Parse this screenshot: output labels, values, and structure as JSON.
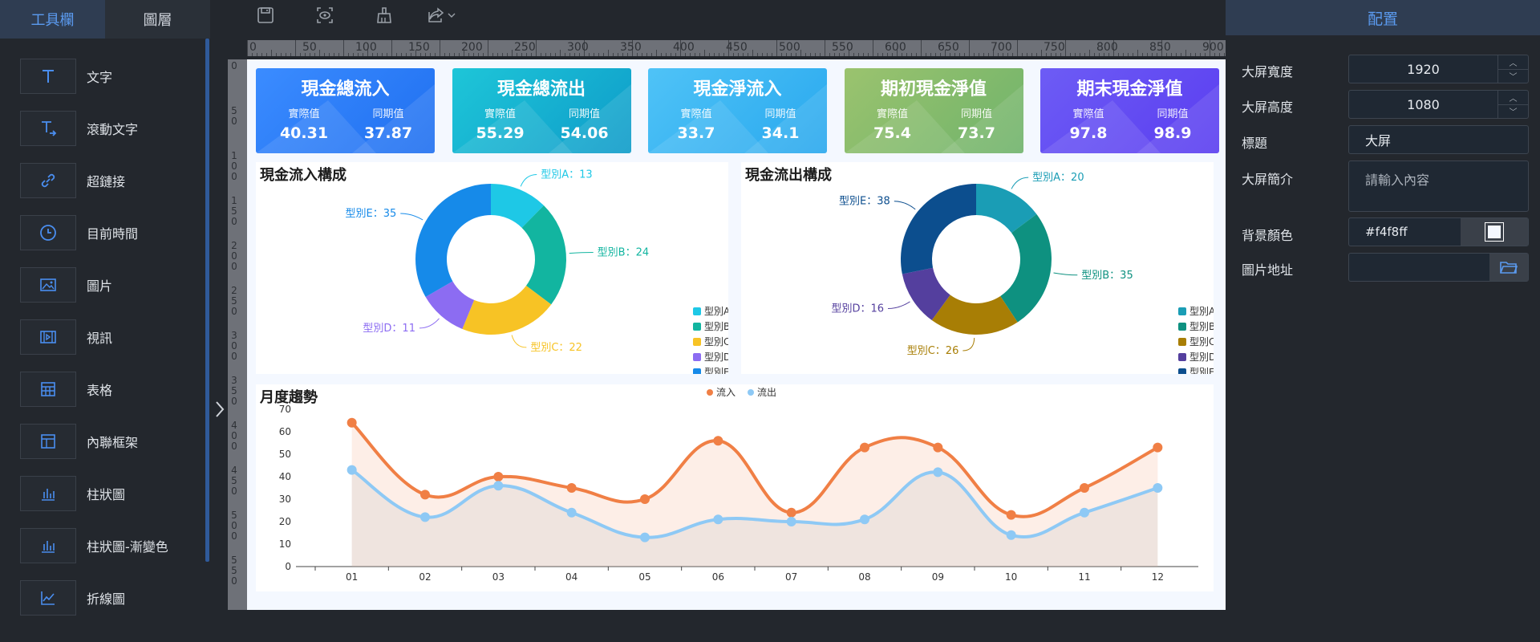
{
  "left_tabs": [
    "工具欄",
    "圖層"
  ],
  "widgets": [
    {
      "label": "文字",
      "icon": "text-icon"
    },
    {
      "label": "滾動文字",
      "icon": "scroll-text-icon"
    },
    {
      "label": "超鏈接",
      "icon": "link-icon"
    },
    {
      "label": "目前時間",
      "icon": "clock-icon"
    },
    {
      "label": "圖片",
      "icon": "image-icon"
    },
    {
      "label": "視訊",
      "icon": "video-icon"
    },
    {
      "label": "表格",
      "icon": "table-icon"
    },
    {
      "label": "內聯框架",
      "icon": "iframe-icon"
    },
    {
      "label": "柱狀圖",
      "icon": "bar-chart-icon"
    },
    {
      "label": "柱狀圖-漸變色",
      "icon": "bar-chart-gradient-icon"
    },
    {
      "label": "折線圖",
      "icon": "line-chart-icon"
    }
  ],
  "toolbar_icons": [
    "save-icon",
    "preview-icon",
    "clean-icon",
    "export-icon"
  ],
  "ruler": {
    "h_labels": [
      "0",
      "50",
      "100",
      "150",
      "200",
      "250",
      "300",
      "350",
      "400",
      "450",
      "500",
      "550",
      "600",
      "650",
      "700",
      "750",
      "800",
      "850",
      "900"
    ]
  },
  "kpis": [
    {
      "title": "現金總流入",
      "l1": "實際值",
      "l2": "同期值",
      "v1": "40.31",
      "v2": "37.87",
      "c1": "#3b8cff",
      "c2": "#1f6ff0"
    },
    {
      "title": "現金總流出",
      "l1": "實際值",
      "l2": "同期值",
      "v1": "55.29",
      "v2": "54.06",
      "c1": "#1ec6d8",
      "c2": "#0e9bc9"
    },
    {
      "title": "現金淨流入",
      "l1": "實際值",
      "l2": "同期值",
      "v1": "33.7",
      "v2": "34.1",
      "c1": "#4fc3f7",
      "c2": "#29a8ee"
    },
    {
      "title": "期初現金淨值",
      "l1": "實際值",
      "l2": "同期值",
      "v1": "75.4",
      "v2": "73.7",
      "c1": "#9bc36e",
      "c2": "#6fb36b"
    },
    {
      "title": "期末現金淨值",
      "l1": "實際值",
      "l2": "同期值",
      "v1": "97.8",
      "v2": "98.9",
      "c1": "#6d5cf5",
      "c2": "#5a3df0"
    }
  ],
  "chart_data": [
    {
      "type": "pie",
      "title": "現金流入構成",
      "categories": [
        "型別A",
        "型別B",
        "型別C",
        "型別D",
        "型別E"
      ],
      "values": [
        13,
        24,
        22,
        11,
        35
      ],
      "labels": [
        "型別A：13",
        "型別B：24",
        "型別C：22",
        "型別D：11",
        "型別E：35"
      ],
      "colors": [
        "#1ec8e6",
        "#12b5a0",
        "#f7c325",
        "#8c6cf2",
        "#168ae9"
      ],
      "legend": "bottom-right"
    },
    {
      "type": "pie",
      "title": "現金流出構成",
      "categories": [
        "型別A",
        "型別B",
        "型別C",
        "型別D",
        "型別E"
      ],
      "values": [
        20,
        35,
        26,
        16,
        38
      ],
      "labels": [
        "型別A：20",
        "型別B：35",
        "型別C：26",
        "型別D：16",
        "型別E：38"
      ],
      "colors": [
        "#1a9db5",
        "#0e9180",
        "#a87e05",
        "#543f9e",
        "#0c4e8e"
      ],
      "legend": "bottom-right"
    },
    {
      "type": "area",
      "title": "月度趨勢",
      "x": [
        "01",
        "02",
        "03",
        "04",
        "05",
        "06",
        "07",
        "08",
        "09",
        "10",
        "11",
        "12"
      ],
      "series": [
        {
          "name": "流入",
          "values": [
            64,
            32,
            40,
            35,
            30,
            56,
            24,
            53,
            53,
            23,
            35,
            53
          ],
          "color": "#f07f45"
        },
        {
          "name": "流出",
          "values": [
            43,
            22,
            36,
            24,
            13,
            21,
            20,
            21,
            42,
            14,
            24,
            35
          ],
          "color": "#8ec9f5"
        }
      ],
      "ylim": [
        0,
        70
      ],
      "yticks": [
        "0",
        "10",
        "20",
        "30",
        "40",
        "50",
        "60",
        "70"
      ],
      "legend": "top-center"
    }
  ],
  "config": {
    "title": "配置",
    "fields": [
      {
        "label": "大屏寬度",
        "value": "1920"
      },
      {
        "label": "大屏高度",
        "value": "1080"
      },
      {
        "label": "標題",
        "value": "大屏"
      },
      {
        "label": "大屏簡介",
        "placeholder": "請輸入內容"
      },
      {
        "label": "背景顏色",
        "value": "#f4f8ff"
      },
      {
        "label": "圖片地址",
        "value": ""
      }
    ]
  }
}
